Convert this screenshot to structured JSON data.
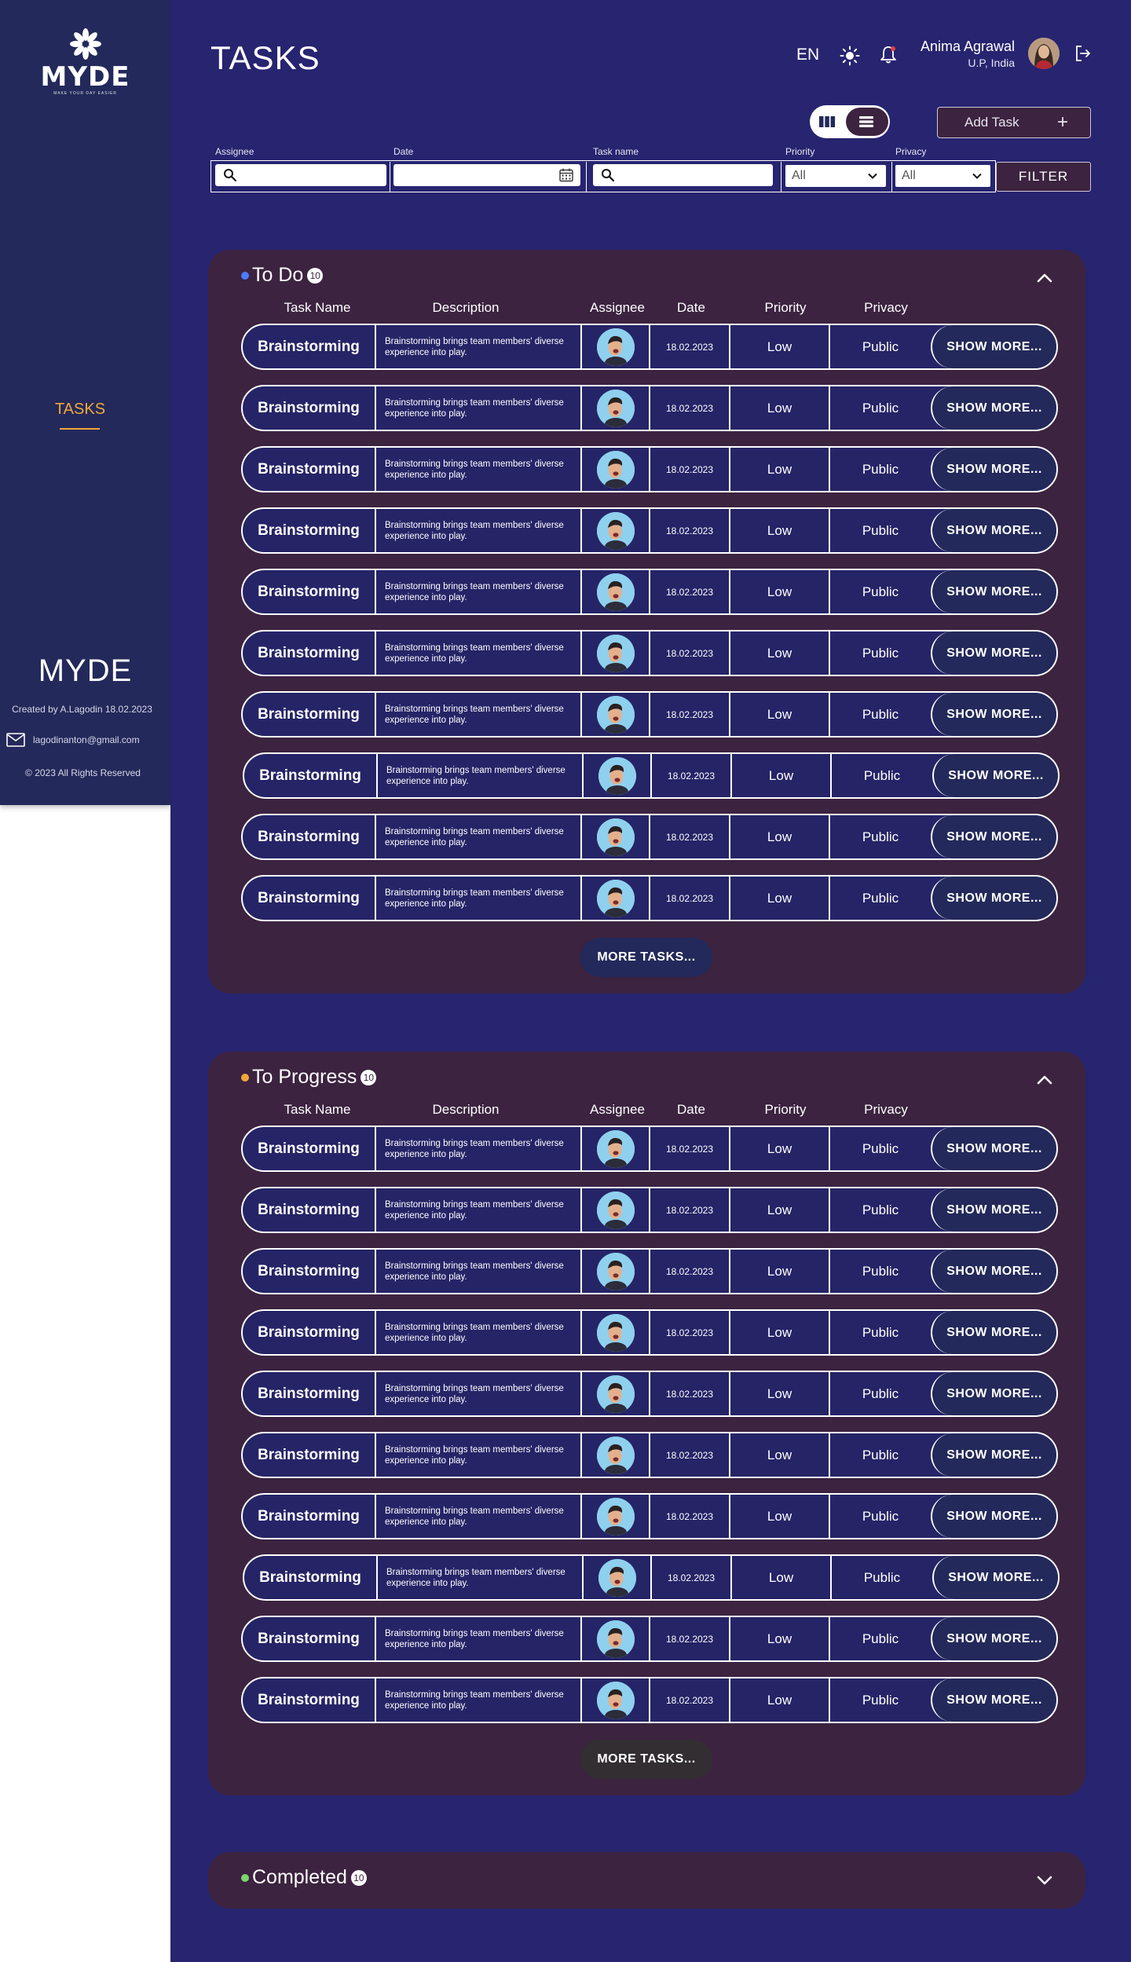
{
  "sidebar": {
    "logo_text": "MYDE",
    "logo_tagline": "MAKE YOUR DAY EASIER",
    "nav_item": "TASKS",
    "footer_brand": "MYDE",
    "created_by": "Created by A.Lagodin 18.02.2023",
    "email": "lagodinanton@gmail.com",
    "rights": "© 2023 All Rights Reserved"
  },
  "header": {
    "title": "TASKS",
    "language": "EN",
    "user_name": "Anima Agrawal",
    "user_location": "U.P, India",
    "add_task_label": "Add Task",
    "add_task_icon": "plus-icon"
  },
  "filters": {
    "assignee_label": "Assignee",
    "date_label": "Date",
    "task_name_label": "Task name",
    "priority_label": "Priority",
    "privacy_label": "Privacy",
    "priority_value": "All",
    "privacy_value": "All",
    "filter_button": "FILTER"
  },
  "columns": {
    "task_name": "Task Name",
    "description": "Description",
    "assignee": "Assignee",
    "date": "Date",
    "priority": "Priority",
    "privacy": "Privacy"
  },
  "sections": [
    {
      "title": "To Do",
      "count": "10",
      "dot_color": "#4f7bff",
      "expanded": true,
      "more_label": "MORE TASKS..."
    },
    {
      "title": "To Progress",
      "count": "10",
      "dot_color": "#f0a83a",
      "expanded": true,
      "more_label": "MORE TASKS..."
    },
    {
      "title": "Completed",
      "count": "10",
      "dot_color": "#7bd66b",
      "expanded": false
    }
  ],
  "task_template": {
    "name": "Brainstorming",
    "description": "Brainstorming brings team members' diverse experience into play.",
    "date": "18.02.2023",
    "priority": "Low",
    "privacy": "Public",
    "action": "SHOW MORE..."
  },
  "colors": {
    "sidebar_bg": "#23295a",
    "main_bg": "#272470",
    "section_bg": "#3c2340",
    "accent": "#f0a83a"
  }
}
